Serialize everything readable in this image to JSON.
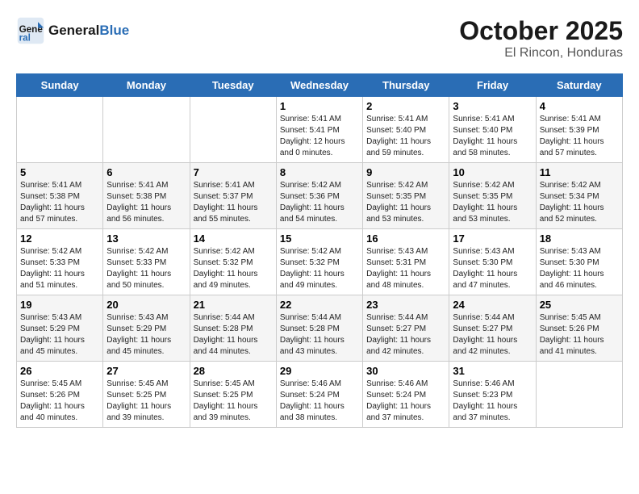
{
  "header": {
    "logo_line1": "General",
    "logo_line2": "Blue",
    "month": "October 2025",
    "location": "El Rincon, Honduras"
  },
  "days_of_week": [
    "Sunday",
    "Monday",
    "Tuesday",
    "Wednesday",
    "Thursday",
    "Friday",
    "Saturday"
  ],
  "weeks": [
    [
      {
        "day": "",
        "info": ""
      },
      {
        "day": "",
        "info": ""
      },
      {
        "day": "",
        "info": ""
      },
      {
        "day": "1",
        "info": "Sunrise: 5:41 AM\nSunset: 5:41 PM\nDaylight: 12 hours\nand 0 minutes."
      },
      {
        "day": "2",
        "info": "Sunrise: 5:41 AM\nSunset: 5:40 PM\nDaylight: 11 hours\nand 59 minutes."
      },
      {
        "day": "3",
        "info": "Sunrise: 5:41 AM\nSunset: 5:40 PM\nDaylight: 11 hours\nand 58 minutes."
      },
      {
        "day": "4",
        "info": "Sunrise: 5:41 AM\nSunset: 5:39 PM\nDaylight: 11 hours\nand 57 minutes."
      }
    ],
    [
      {
        "day": "5",
        "info": "Sunrise: 5:41 AM\nSunset: 5:38 PM\nDaylight: 11 hours\nand 57 minutes."
      },
      {
        "day": "6",
        "info": "Sunrise: 5:41 AM\nSunset: 5:38 PM\nDaylight: 11 hours\nand 56 minutes."
      },
      {
        "day": "7",
        "info": "Sunrise: 5:41 AM\nSunset: 5:37 PM\nDaylight: 11 hours\nand 55 minutes."
      },
      {
        "day": "8",
        "info": "Sunrise: 5:42 AM\nSunset: 5:36 PM\nDaylight: 11 hours\nand 54 minutes."
      },
      {
        "day": "9",
        "info": "Sunrise: 5:42 AM\nSunset: 5:35 PM\nDaylight: 11 hours\nand 53 minutes."
      },
      {
        "day": "10",
        "info": "Sunrise: 5:42 AM\nSunset: 5:35 PM\nDaylight: 11 hours\nand 53 minutes."
      },
      {
        "day": "11",
        "info": "Sunrise: 5:42 AM\nSunset: 5:34 PM\nDaylight: 11 hours\nand 52 minutes."
      }
    ],
    [
      {
        "day": "12",
        "info": "Sunrise: 5:42 AM\nSunset: 5:33 PM\nDaylight: 11 hours\nand 51 minutes."
      },
      {
        "day": "13",
        "info": "Sunrise: 5:42 AM\nSunset: 5:33 PM\nDaylight: 11 hours\nand 50 minutes."
      },
      {
        "day": "14",
        "info": "Sunrise: 5:42 AM\nSunset: 5:32 PM\nDaylight: 11 hours\nand 49 minutes."
      },
      {
        "day": "15",
        "info": "Sunrise: 5:42 AM\nSunset: 5:32 PM\nDaylight: 11 hours\nand 49 minutes."
      },
      {
        "day": "16",
        "info": "Sunrise: 5:43 AM\nSunset: 5:31 PM\nDaylight: 11 hours\nand 48 minutes."
      },
      {
        "day": "17",
        "info": "Sunrise: 5:43 AM\nSunset: 5:30 PM\nDaylight: 11 hours\nand 47 minutes."
      },
      {
        "day": "18",
        "info": "Sunrise: 5:43 AM\nSunset: 5:30 PM\nDaylight: 11 hours\nand 46 minutes."
      }
    ],
    [
      {
        "day": "19",
        "info": "Sunrise: 5:43 AM\nSunset: 5:29 PM\nDaylight: 11 hours\nand 45 minutes."
      },
      {
        "day": "20",
        "info": "Sunrise: 5:43 AM\nSunset: 5:29 PM\nDaylight: 11 hours\nand 45 minutes."
      },
      {
        "day": "21",
        "info": "Sunrise: 5:44 AM\nSunset: 5:28 PM\nDaylight: 11 hours\nand 44 minutes."
      },
      {
        "day": "22",
        "info": "Sunrise: 5:44 AM\nSunset: 5:28 PM\nDaylight: 11 hours\nand 43 minutes."
      },
      {
        "day": "23",
        "info": "Sunrise: 5:44 AM\nSunset: 5:27 PM\nDaylight: 11 hours\nand 42 minutes."
      },
      {
        "day": "24",
        "info": "Sunrise: 5:44 AM\nSunset: 5:27 PM\nDaylight: 11 hours\nand 42 minutes."
      },
      {
        "day": "25",
        "info": "Sunrise: 5:45 AM\nSunset: 5:26 PM\nDaylight: 11 hours\nand 41 minutes."
      }
    ],
    [
      {
        "day": "26",
        "info": "Sunrise: 5:45 AM\nSunset: 5:26 PM\nDaylight: 11 hours\nand 40 minutes."
      },
      {
        "day": "27",
        "info": "Sunrise: 5:45 AM\nSunset: 5:25 PM\nDaylight: 11 hours\nand 39 minutes."
      },
      {
        "day": "28",
        "info": "Sunrise: 5:45 AM\nSunset: 5:25 PM\nDaylight: 11 hours\nand 39 minutes."
      },
      {
        "day": "29",
        "info": "Sunrise: 5:46 AM\nSunset: 5:24 PM\nDaylight: 11 hours\nand 38 minutes."
      },
      {
        "day": "30",
        "info": "Sunrise: 5:46 AM\nSunset: 5:24 PM\nDaylight: 11 hours\nand 37 minutes."
      },
      {
        "day": "31",
        "info": "Sunrise: 5:46 AM\nSunset: 5:23 PM\nDaylight: 11 hours\nand 37 minutes."
      },
      {
        "day": "",
        "info": ""
      }
    ]
  ]
}
